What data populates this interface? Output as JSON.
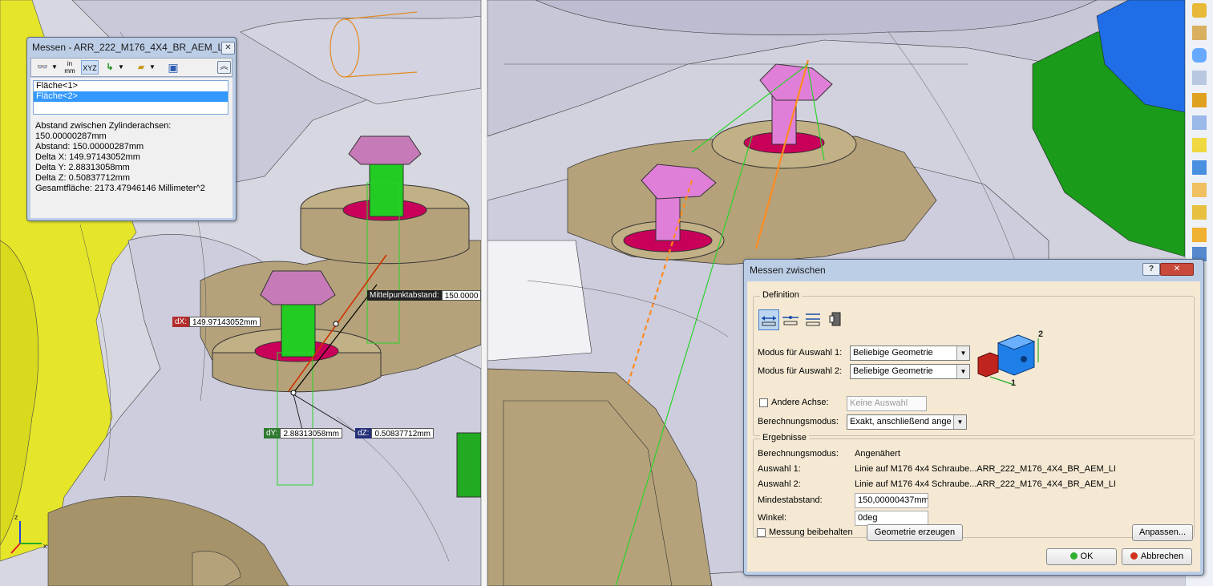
{
  "messen": {
    "title": "Messen - ARR_222_M176_4X4_BR_AEM_LI...",
    "unit_icon_top": "in",
    "unit_icon_bottom": "mm",
    "selections": [
      "Fläche<1>",
      "Fläche<2>"
    ],
    "results": [
      "Abstand zwischen Zylinderachsen:",
      "150.00000287mm",
      "Abstand: 150.00000287mm",
      "Delta X: 149.97143052mm",
      "Delta Y: 2.88313058mm",
      "Delta Z: 0.50837712mm",
      "Gesamtfläche: 2173.47946146 Millimeter^2"
    ]
  },
  "viewport_left": {
    "dx_tag": "dX:",
    "dx_value": "149.97143052mm",
    "dy_tag": "dY:",
    "dy_value": "2.88313058mm",
    "dz_tag": "dZ:",
    "dz_value": "0.50837712mm",
    "center_label": "Mittelpunktabstand:",
    "center_value": "150.0000",
    "axis_z": "z",
    "axis_x": "x"
  },
  "dialog": {
    "title": "Messen zwischen",
    "help": "?",
    "definition_label": "Definition",
    "mode1_label": "Modus für Auswahl 1:",
    "mode1_value": "Beliebige Geometrie",
    "mode2_label": "Modus für Auswahl 2:",
    "mode2_value": "Beliebige Geometrie",
    "preview_label_1": "1",
    "preview_label_2": "2",
    "other_axis_label": "Andere Achse:",
    "other_axis_placeholder": "Keine Auswahl",
    "calc_mode_label": "Berechnungsmodus:",
    "calc_mode_value": "Exakt, anschließend ange",
    "results_label": "Ergebnisse",
    "res_calc_label": "Berechnungsmodus:",
    "res_calc_value": "Angenähert",
    "sel1_label": "Auswahl 1:",
    "sel1_value": "Linie auf M176 4x4 Schraube...ARR_222_M176_4X4_BR_AEM_LI",
    "sel2_label": "Auswahl 2:",
    "sel2_value": "Linie auf M176 4x4 Schraube...ARR_222_M176_4X4_BR_AEM_LI",
    "min_dist_label": "Mindestabstand:",
    "min_dist_value": "150,00000437mm",
    "angle_label": "Winkel:",
    "angle_value": "0deg",
    "keep_label": "Messung beibehalten",
    "create_geom": "Geometrie erzeugen",
    "customize": "Anpassen...",
    "ok": "OK",
    "cancel": "Abbrechen"
  },
  "colors": {
    "bolt_head": "#c77ab8",
    "bolt_shaft": "#22cc22",
    "washer": "#c8005a",
    "bracket": "#b5a27a",
    "yellow_part": "#e5e52a",
    "dialog_bg": "#f5e9d4",
    "window_frame": "#bccde6"
  }
}
